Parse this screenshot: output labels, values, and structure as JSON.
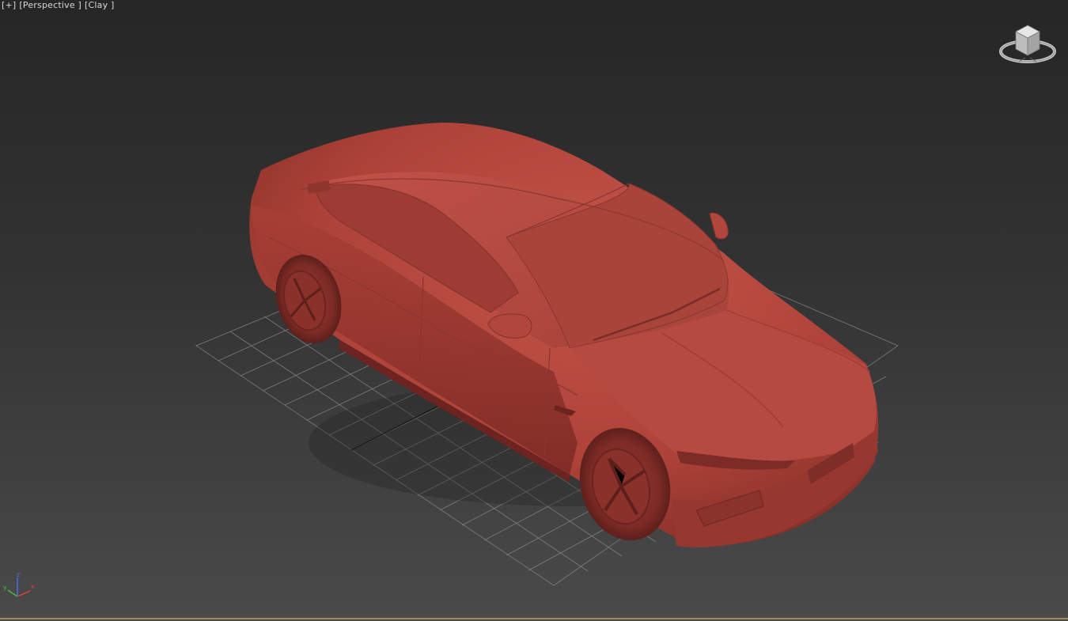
{
  "viewport": {
    "labels": {
      "plus": "[+]",
      "view": "[Perspective ]",
      "shading": "[Clay ]"
    },
    "viewcube_icon": "viewcube-icon",
    "model_color": "#b84a40",
    "grid_color": "#8c8c8c",
    "axis": {
      "x_label": "x",
      "y_label": "y",
      "z_label": "z",
      "x_color": "#e04040",
      "y_color": "#40c040",
      "z_color": "#4a6ee0"
    }
  }
}
